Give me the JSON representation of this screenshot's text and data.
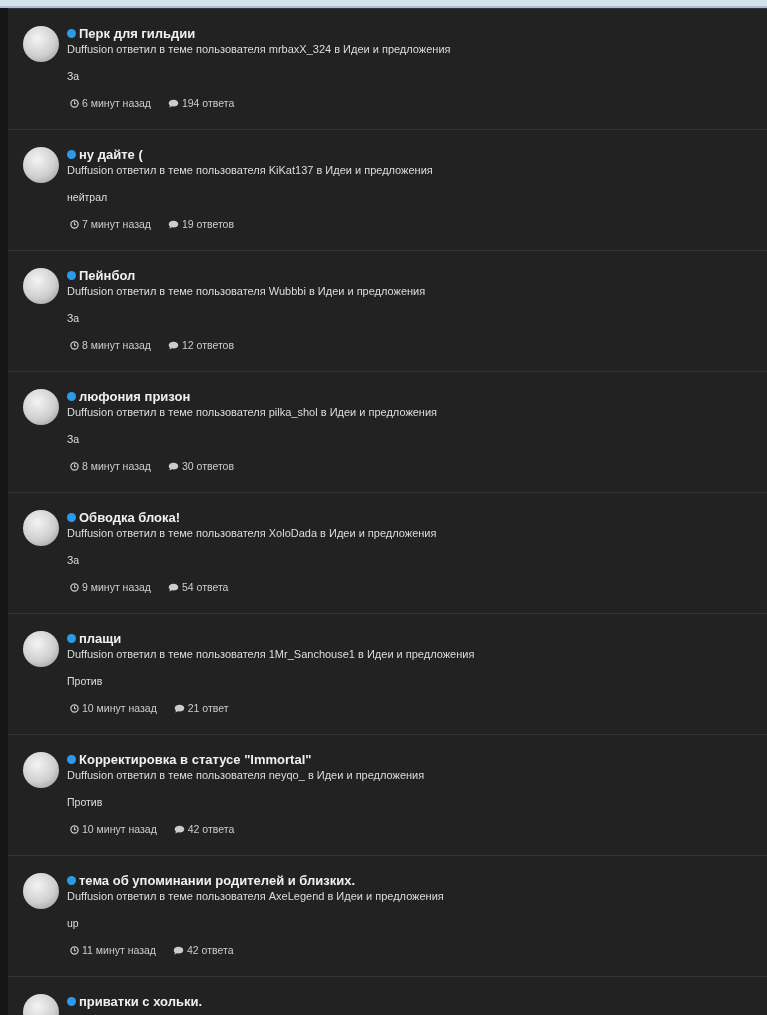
{
  "activity": [
    {
      "title": "Перк для гильдии",
      "unread": true,
      "summary": "Duffusion ответил в теме пользователя mrbaxX_324 в Идеи и предложения",
      "snippet": "За",
      "time": "6 минут назад",
      "replies": "194 ответа"
    },
    {
      "title": "ну дайте (",
      "unread": true,
      "summary": "Duffusion ответил в теме пользователя KiKat137 в Идеи и предложения",
      "snippet": "нейтрал",
      "time": "7 минут назад",
      "replies": "19 ответов"
    },
    {
      "title": "Пейнбол",
      "unread": true,
      "summary": "Duffusion ответил в теме пользователя Wubbbi в Идеи и предложения",
      "snippet": "За",
      "time": "8 минут назад",
      "replies": "12 ответов"
    },
    {
      "title": "люфония призон",
      "unread": true,
      "summary": "Duffusion ответил в теме пользователя pilka_shol в Идеи и предложения",
      "snippet": "За",
      "time": "8 минут назад",
      "replies": "30 ответов"
    },
    {
      "title": "Обводка блока!",
      "unread": true,
      "summary": "Duffusion ответил в теме пользователя XoloDada в Идеи и предложения",
      "snippet": "За",
      "time": "9 минут назад",
      "replies": "54 ответа"
    },
    {
      "title": "плащи",
      "unread": true,
      "summary": "Duffusion ответил в теме пользователя 1Mr_Sanchouse1 в Идеи и предложения",
      "snippet": "Против",
      "time": "10 минут назад",
      "replies": "21 ответ"
    },
    {
      "title": "Корректировка в статусе \"Immortal\"",
      "unread": true,
      "summary": "Duffusion ответил в теме пользователя neyqo_ в Идеи и предложения",
      "snippet": "Против",
      "time": "10 минут назад",
      "replies": "42 ответа"
    },
    {
      "title": "тема об упоминании родителей и близких.",
      "unread": true,
      "summary": "Duffusion ответил в теме пользователя AxeLegend в Идеи и предложения",
      "snippet": "up",
      "time": "11 минут назад",
      "replies": "42 ответа"
    },
    {
      "title": "приватки с хольки.",
      "unread": true
    }
  ]
}
